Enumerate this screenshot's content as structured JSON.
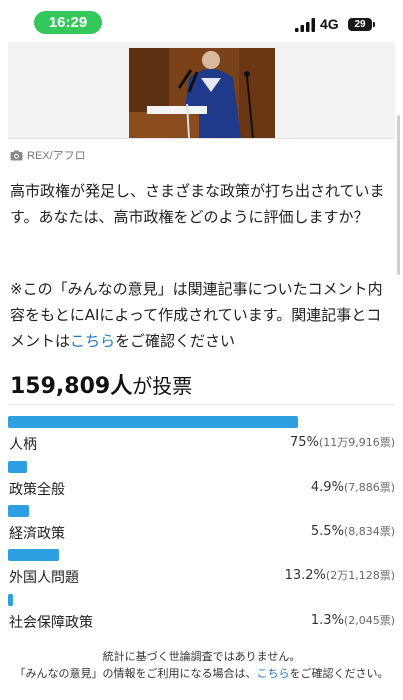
{
  "status_bar": {
    "time": "16:29",
    "network": "4G",
    "battery": "29"
  },
  "photo": {
    "credit_icon": "camera-icon",
    "credit": "REX/アフロ"
  },
  "question": "高市政権が発足し、さまざまな政策が打ち出されています。あなたは、高市政権をどのように評価しますか？",
  "note": {
    "before": "※この「みんなの意見」は関連記事についたコメント内容をもとにAIによって作成されています。関連記事とコメントは",
    "link": "こちら",
    "after": "をご確認ください"
  },
  "votes": {
    "count": "159,809",
    "unit": "人",
    "suffix": "が投票"
  },
  "options": [
    {
      "label": "人柄",
      "percent": 75,
      "percent_text": "75%",
      "count_text": "(11万9,916票)"
    },
    {
      "label": "政策全般",
      "percent": 4.9,
      "percent_text": "4.9%",
      "count_text": "(7,886票)"
    },
    {
      "label": "経済政策",
      "percent": 5.5,
      "percent_text": "5.5%",
      "count_text": "(8,834票)"
    },
    {
      "label": "外国人問題",
      "percent": 13.2,
      "percent_text": "13.2%",
      "count_text": "(2万1,128票)"
    },
    {
      "label": "社会保障政策",
      "percent": 1.3,
      "percent_text": "1.3%",
      "count_text": "(2,045票)"
    }
  ],
  "footer": {
    "line1": "統計に基づく世論調査ではありません。",
    "line2_before": "「みんなの意見」の情報をご利用になる場合は、",
    "line2_link": "こちら",
    "line2_after": "をご確認ください。"
  },
  "colors": {
    "bar": "#2e9fe0",
    "link": "#1f7ac4",
    "time_pill": "#34c759"
  }
}
